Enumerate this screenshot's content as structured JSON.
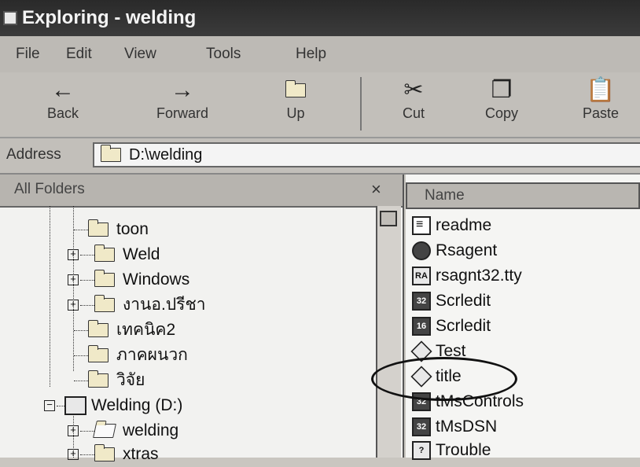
{
  "window": {
    "title": "Exploring - welding"
  },
  "menu": [
    "File",
    "Edit",
    "View",
    "Tools",
    "Help"
  ],
  "toolbar": {
    "back": "Back",
    "forward": "Forward",
    "up": "Up",
    "cut": "Cut",
    "copy": "Copy",
    "paste": "Paste"
  },
  "address": {
    "label": "Address",
    "value": "D:\\welding"
  },
  "left_panel": {
    "header": "All Folders",
    "close": "×",
    "tree": [
      {
        "label": "toon",
        "expander": ""
      },
      {
        "label": "Weld",
        "expander": "+"
      },
      {
        "label": "Windows",
        "expander": "+"
      },
      {
        "label": "งานอ.ปรีชา",
        "expander": "+"
      },
      {
        "label": "เทคนิค2",
        "expander": ""
      },
      {
        "label": "ภาคผนวก",
        "expander": ""
      },
      {
        "label": "วิจัย",
        "expander": ""
      },
      {
        "label": "Welding (D:)",
        "expander": "−"
      },
      {
        "label": "welding",
        "expander": "+"
      },
      {
        "label": "xtras",
        "expander": "+"
      }
    ]
  },
  "right_panel": {
    "header": "Name",
    "files": [
      {
        "name": "readme",
        "icon": "text-file-icon"
      },
      {
        "name": "Rsagent",
        "icon": "agent-icon"
      },
      {
        "name": "rsagnt32.tty",
        "icon": "tty-file-icon"
      },
      {
        "name": "Scrledit",
        "icon": "app-32-icon"
      },
      {
        "name": "Scrledit",
        "icon": "app-16-icon"
      },
      {
        "name": "Test",
        "icon": "gear-file-icon"
      },
      {
        "name": "title",
        "icon": "gear-file-icon"
      },
      {
        "name": "tMsControls",
        "icon": "app-32-icon"
      },
      {
        "name": "tMsDSN",
        "icon": "app-32-icon"
      },
      {
        "name": "Trouble",
        "icon": "help-file-icon"
      }
    ]
  }
}
